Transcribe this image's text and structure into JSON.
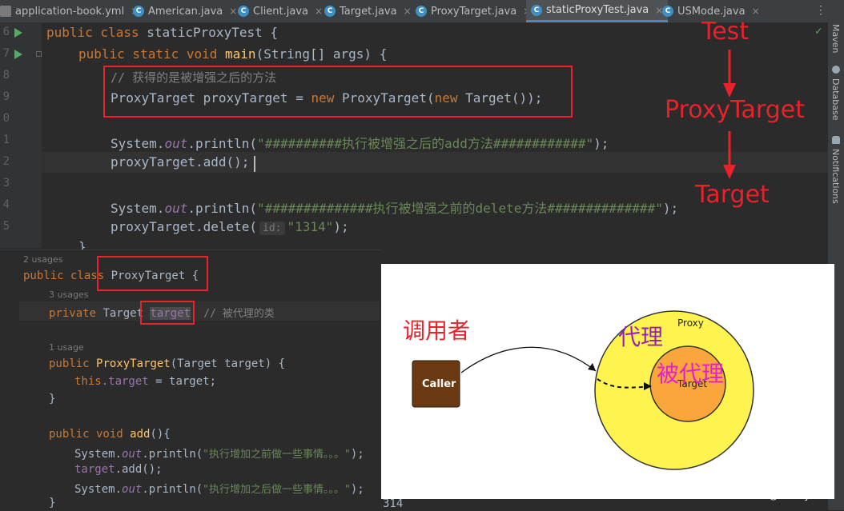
{
  "tabs": [
    {
      "label": "application-book.yml",
      "icon": "yaml-icon",
      "active": false
    },
    {
      "label": "American.java",
      "icon": "java-class-icon",
      "active": false
    },
    {
      "label": "Client.java",
      "icon": "java-class-icon",
      "active": false
    },
    {
      "label": "Target.java",
      "icon": "java-class-icon",
      "active": false
    },
    {
      "label": "ProxyTarget.java",
      "icon": "java-class-icon",
      "active": false
    },
    {
      "label": "staticProxyTest.java",
      "icon": "java-class-icon",
      "active": true
    },
    {
      "label": "USMode.java",
      "icon": "java-class-icon",
      "active": false
    }
  ],
  "tab_close": "×",
  "tab_more": "⋮",
  "side_tools": [
    "Maven",
    "Database",
    "Notifications"
  ],
  "line_numbers": [
    "6",
    "7",
    "8",
    "9",
    "0",
    "1",
    "2",
    "3",
    "4",
    "5",
    "6"
  ],
  "code": {
    "l1_kw": "public class ",
    "l1_rest": "staticProxyTest {",
    "l2_kw": "public static void ",
    "l2_fn": "main",
    "l2_rest": "(String[] args) {",
    "l3_comment": "// 获得的是被增强之后的方法",
    "l4_a": "ProxyTarget proxyTarget = ",
    "l4_new1": "new ",
    "l4_b": "ProxyTarget(",
    "l4_new2": "new ",
    "l4_c": "Target());",
    "l5_a": "System.",
    "l5_out": "out",
    "l5_b": ".println(",
    "l5_str": "\"##########执行被增强之后的add方法############\"",
    "l5_c": ");",
    "l6": "proxyTarget.add();",
    "l7_a": "System.",
    "l7_out": "out",
    "l7_b": ".println(",
    "l7_str": "\"##############执行被增强之前的delete方法##############\"",
    "l7_c": ");",
    "l8_a": "proxyTarget.delete(",
    "l8_hint": "id:",
    "l8_str": "\"1314\"",
    "l8_c": ");",
    "l9": "}"
  },
  "annotations": {
    "flow": [
      "Test",
      "ProxyTarget",
      "Target"
    ]
  },
  "panel": {
    "usage1": "2 usages",
    "class_kw": "public class ",
    "class_name": "ProxyTarget {",
    "usage2": "3 usages",
    "field_kw": "private ",
    "field_type": "Target ",
    "field_name": "target",
    "field_semi": ";",
    "field_comment": " // 被代理的类",
    "usage3": "1 usage",
    "ctor_kw": "public ",
    "ctor_name": "ProxyTarget",
    "ctor_params": "(Target target) {",
    "this_kw": "this",
    "this_field": ".target",
    "this_rest": " = target;",
    "brace": "}",
    "add_kw": "public void ",
    "add_name": "add",
    "add_rest": "(){",
    "p1_a": "System.",
    "p1_out": "out",
    "p1_b": ".println(",
    "p1_str": "\"执行增加之前做一些事情。。。\"",
    "p1_c": ");",
    "p2_field": "target",
    "p2_rest": ".add();",
    "p3_a": "System.",
    "p3_out": "out",
    "p3_b": ".println(",
    "p3_str": "\"执行增加之后做一些事情。。。\"",
    "p3_c": ");",
    "close": "}"
  },
  "peek_text": "314",
  "diagram": {
    "caller_cn": "调用者",
    "caller": "Caller",
    "proxy_cn": "代理",
    "proxy": "Proxy",
    "target_cn": "被代理",
    "target": "Target",
    "colors": {
      "outer": "#fff44f",
      "inner": "#fba63c",
      "caller_box": "#6b3a12"
    }
  },
  "watermark": "CSDN @Parley620",
  "colors": {
    "editor_bg": "#2b2b2b",
    "keyword": "#cc7832",
    "string": "#6a8759",
    "annotation_red": "#e8212a"
  }
}
